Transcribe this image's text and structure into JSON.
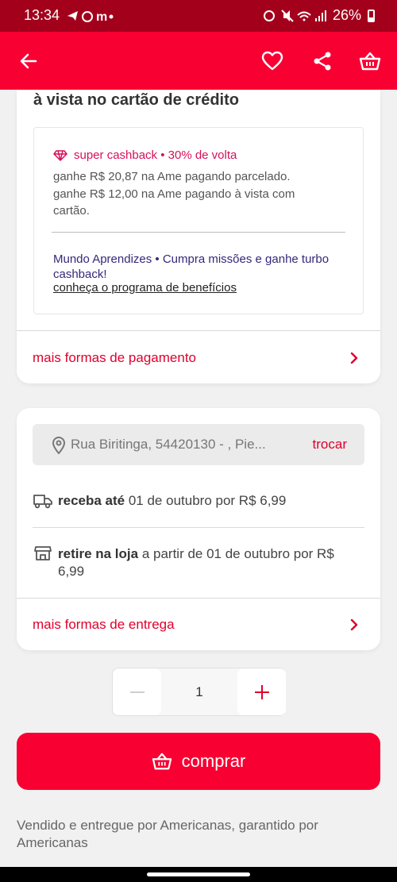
{
  "status_bar": {
    "time": "13:34",
    "left_icons": "telegram m •",
    "battery": "26%"
  },
  "header": {
    "back_icon": "arrow-left-icon",
    "favorite_icon": "heart-icon",
    "share_icon": "share-icon",
    "basket_icon": "basket-icon"
  },
  "payment": {
    "title_fragment": "à vista no cartão de crédito",
    "cashback_title": "super cashback • 30% de volta",
    "cashback_line1": "ganhe R$ 20,87 na Ame pagando parcelado.",
    "cashback_line2": "ganhe R$ 12,00 na Ame pagando à vista com cartão.",
    "mundo_text": "Mundo Aprendizes • Cumpra missões e ganhe turbo cashback!",
    "program_link": "conheça o programa de benefícios",
    "more_payment_link": "mais formas de pagamento"
  },
  "shipping": {
    "address": "Rua Biritinga, 54420130 - , Pie...",
    "change_label": "trocar",
    "delivery_bold": "receba até",
    "delivery_rest": " 01 de outubro por R$ 6,99",
    "pickup_bold": "retire na loja",
    "pickup_rest": " a partir de 01 de outubro por R$ 6,99",
    "more_shipping_link": "mais formas de entrega"
  },
  "quantity": {
    "value": "1"
  },
  "buy_button": {
    "label": "comprar"
  },
  "seller": {
    "text": "Vendido e entregue por Americanas, garantido por Americanas"
  },
  "colors": {
    "brand_red": "#f80032",
    "status_dark_red": "#a3001c",
    "cashback_pink": "#d6105a",
    "mundo_purple": "#34287a"
  }
}
